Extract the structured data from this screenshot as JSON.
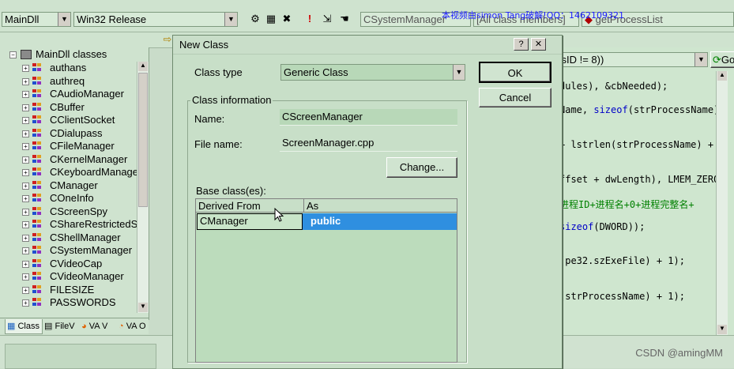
{
  "watermark": "本视频由simon Tang破解!QQ：1462109321",
  "csdn": "CSDN @amingMM",
  "toolbar": {
    "project_combo": "MainDll",
    "config_combo": "Win32 Release",
    "class_combo": "CSystemManager",
    "members_combo": "[All class members]",
    "function_combo": "getProcessList",
    "goto_combo": "ssID != 8))",
    "go_label": "Go"
  },
  "classview": {
    "root": "MainDll classes",
    "items": [
      "authans",
      "authreq",
      "CAudioManager",
      "CBuffer",
      "CClientSocket",
      "CDialupass",
      "CFileManager",
      "CKernelManager",
      "CKeyboardManage",
      "CManager",
      "COneInfo",
      "CScreenSpy",
      "CShareRestrictedS",
      "CShellManager",
      "CSystemManager",
      "CVideoCap",
      "CVideoManager",
      "FILESIZE",
      "PASSWORDS"
    ],
    "tabs": [
      "Class",
      "FileV",
      "VA V",
      "VA O"
    ]
  },
  "editor": {
    "lines": [
      {
        "parts": [
          {
            "t": "dules), &cbNeeded);",
            "c": ""
          }
        ]
      },
      {
        "parts": [
          {
            "t": "Name, ",
            "c": ""
          },
          {
            "t": "sizeof",
            "c": "kw"
          },
          {
            "t": "(strProcessName))",
            "c": ""
          }
        ]
      },
      {
        "parts": [
          {
            "t": "+ lstrlen(strProcessName) +",
            "c": ""
          }
        ]
      },
      {
        "parts": [
          {
            "t": "ffset + dwLength), LMEM_ZEROI",
            "c": ""
          }
        ]
      },
      {
        "parts": [
          {
            "t": "进程ID+进程名+0+进程完整名+",
            "c": "cm"
          }
        ]
      },
      {
        "parts": [
          {
            "t": "sizeof",
            "c": "kw"
          },
          {
            "t": "(DWORD));",
            "c": ""
          }
        ]
      },
      {
        "parts": [
          {
            "t": "(pe32.szExeFile) + 1);",
            "c": ""
          }
        ]
      },
      {
        "parts": [
          {
            "t": "(strProcessName) + 1);",
            "c": ""
          }
        ]
      }
    ]
  },
  "dialog": {
    "title": "New Class",
    "help_btn": "?",
    "close_btn": "✕",
    "class_type_label": "Class type",
    "class_type_value": "Generic Class",
    "ok_label": "OK",
    "cancel_label": "Cancel",
    "class_info_label": "Class information",
    "name_label": "Name:",
    "name_value": "CScreenManager",
    "file_label": "File name:",
    "file_value": "ScreenManager.cpp",
    "change_label": "Change...",
    "base_label": "Base class(es):",
    "col_derived": "Derived From",
    "col_as": "As",
    "row_derived": "CManager",
    "row_as": "public"
  }
}
